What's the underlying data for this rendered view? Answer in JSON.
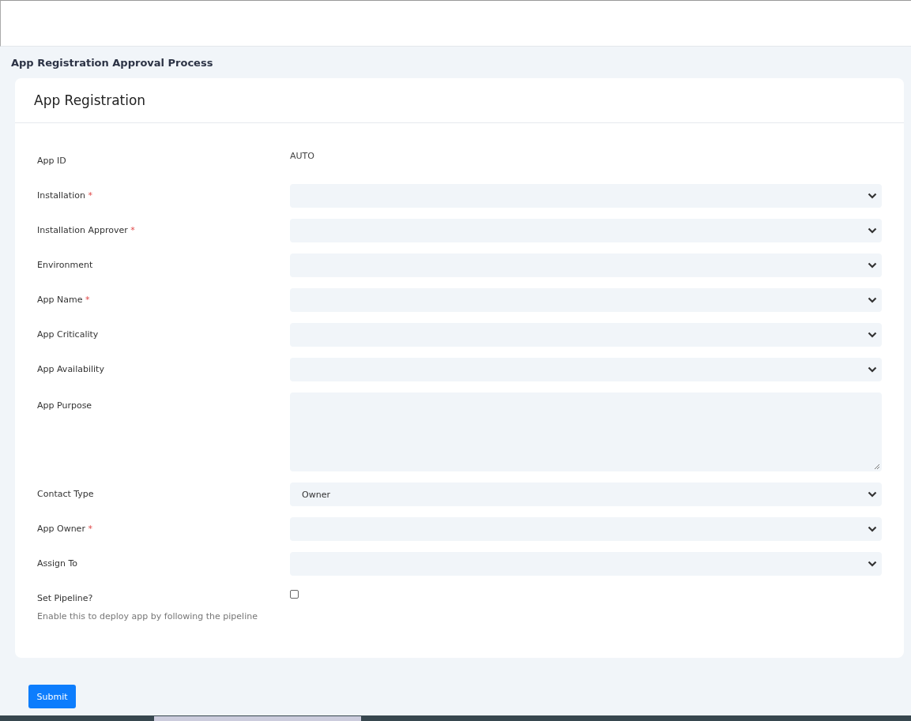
{
  "page_title": "App Registration Approval Process",
  "card": {
    "title": "App Registration",
    "fields": [
      {
        "kind": "static",
        "label": "App ID",
        "value": "AUTO"
      },
      {
        "kind": "select",
        "label": "Installation",
        "required_mark": "*"
      },
      {
        "kind": "select",
        "label": "Installation Approver",
        "required_mark": "*"
      },
      {
        "kind": "select",
        "label": "Environment"
      },
      {
        "kind": "select",
        "label": "App Name",
        "required_mark": "*"
      },
      {
        "kind": "select",
        "label": "App Criticality"
      },
      {
        "kind": "select",
        "label": "App Availability"
      },
      {
        "kind": "textarea",
        "label": "App Purpose"
      },
      {
        "kind": "select",
        "label": "Contact Type",
        "value": "Owner"
      },
      {
        "kind": "select",
        "label": "App Owner",
        "required_mark": "*"
      },
      {
        "kind": "select",
        "label": "Assign To"
      },
      {
        "kind": "checkbox",
        "label": "Set Pipeline?",
        "help": "Enable this to deploy app by following the pipeline",
        "checked": false
      }
    ]
  },
  "submit_button": "Submit"
}
